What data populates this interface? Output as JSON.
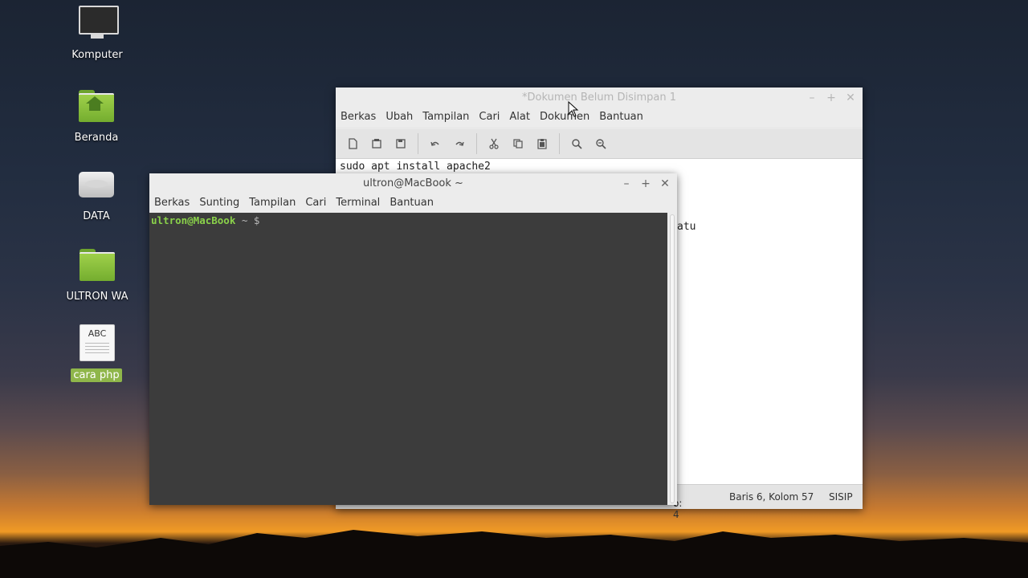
{
  "desktop": {
    "icons": [
      {
        "label": "Komputer",
        "icon": "computer-icon"
      },
      {
        "label": "Beranda",
        "icon": "home-folder-icon"
      },
      {
        "label": "DATA",
        "icon": "drive-icon"
      },
      {
        "label": "ULTRON WA",
        "icon": "folder-icon"
      },
      {
        "label": "cara php",
        "icon": "text-document-icon",
        "doc_glyph": "ABC",
        "selected": true
      }
    ]
  },
  "editor": {
    "title": "*Dokumen Belum Disimpan 1",
    "menu": [
      "Berkas",
      "Ubah",
      "Tampilan",
      "Cari",
      "Alat",
      "Dokumen",
      "Bantuan"
    ],
    "toolbar": [
      "new-document-icon",
      "open-icon",
      "save-icon",
      "undo-icon",
      "redo-icon",
      "cut-icon",
      "copy-icon",
      "paste-icon",
      "search-icon",
      "replace-icon"
    ],
    "lines": {
      "line1": "sudo apt install apache2",
      "line2_visible": "atu"
    },
    "status": {
      "tab_width": "o: 4",
      "position": "Baris 6, Kolom 57",
      "mode": "SISIP"
    }
  },
  "terminal": {
    "title": "ultron@MacBook ~",
    "menu": [
      "Berkas",
      "Sunting",
      "Tampilan",
      "Cari",
      "Terminal",
      "Bantuan"
    ],
    "prompt_user": "ultron@MacBook",
    "prompt_rest": " ~ $"
  },
  "window_buttons": {
    "minimize": "–",
    "maximize": "+",
    "close": "✕"
  }
}
